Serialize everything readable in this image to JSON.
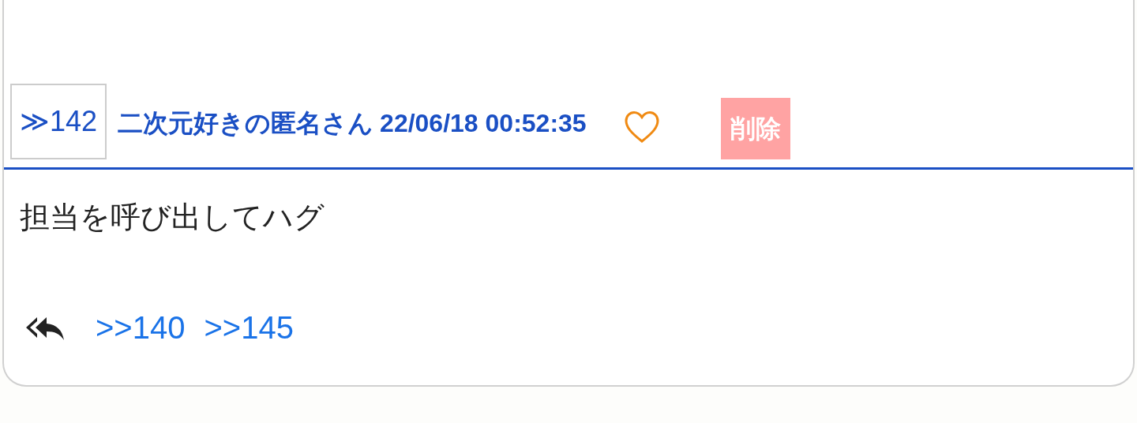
{
  "post": {
    "number": "≫142",
    "author": "二次元好きの匿名さん",
    "timestamp": "22/06/18 00:52:35",
    "liked": false,
    "delete_label": "削除",
    "body": "担当を呼び出してハグ",
    "replies": [
      ">>140",
      ">>145"
    ]
  }
}
